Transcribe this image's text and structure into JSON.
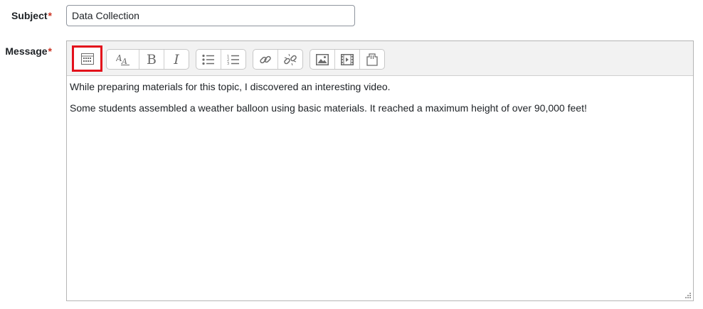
{
  "form": {
    "subject_label": "Subject",
    "message_label": "Message",
    "required_marker": "*",
    "subject_value": "Data Collection"
  },
  "toolbar": {
    "buttons": [
      {
        "icon": "toolbar-toggle-icon",
        "highlighted": true
      },
      {
        "icon": "font-size-icon"
      },
      {
        "icon": "bold-icon",
        "text": "B"
      },
      {
        "icon": "italic-icon",
        "text": "I"
      },
      {
        "icon": "unordered-list-icon"
      },
      {
        "icon": "ordered-list-icon"
      },
      {
        "icon": "link-icon"
      },
      {
        "icon": "unlink-icon"
      },
      {
        "icon": "image-icon"
      },
      {
        "icon": "media-icon"
      },
      {
        "icon": "file-manager-icon"
      }
    ],
    "highlight_color": "#e3101b"
  },
  "editor": {
    "paragraphs": [
      "While preparing materials for this topic, I discovered an interesting video.",
      "Some students assembled a weather balloon using basic materials.  It reached a maximum height of over 90,000 feet!"
    ]
  }
}
